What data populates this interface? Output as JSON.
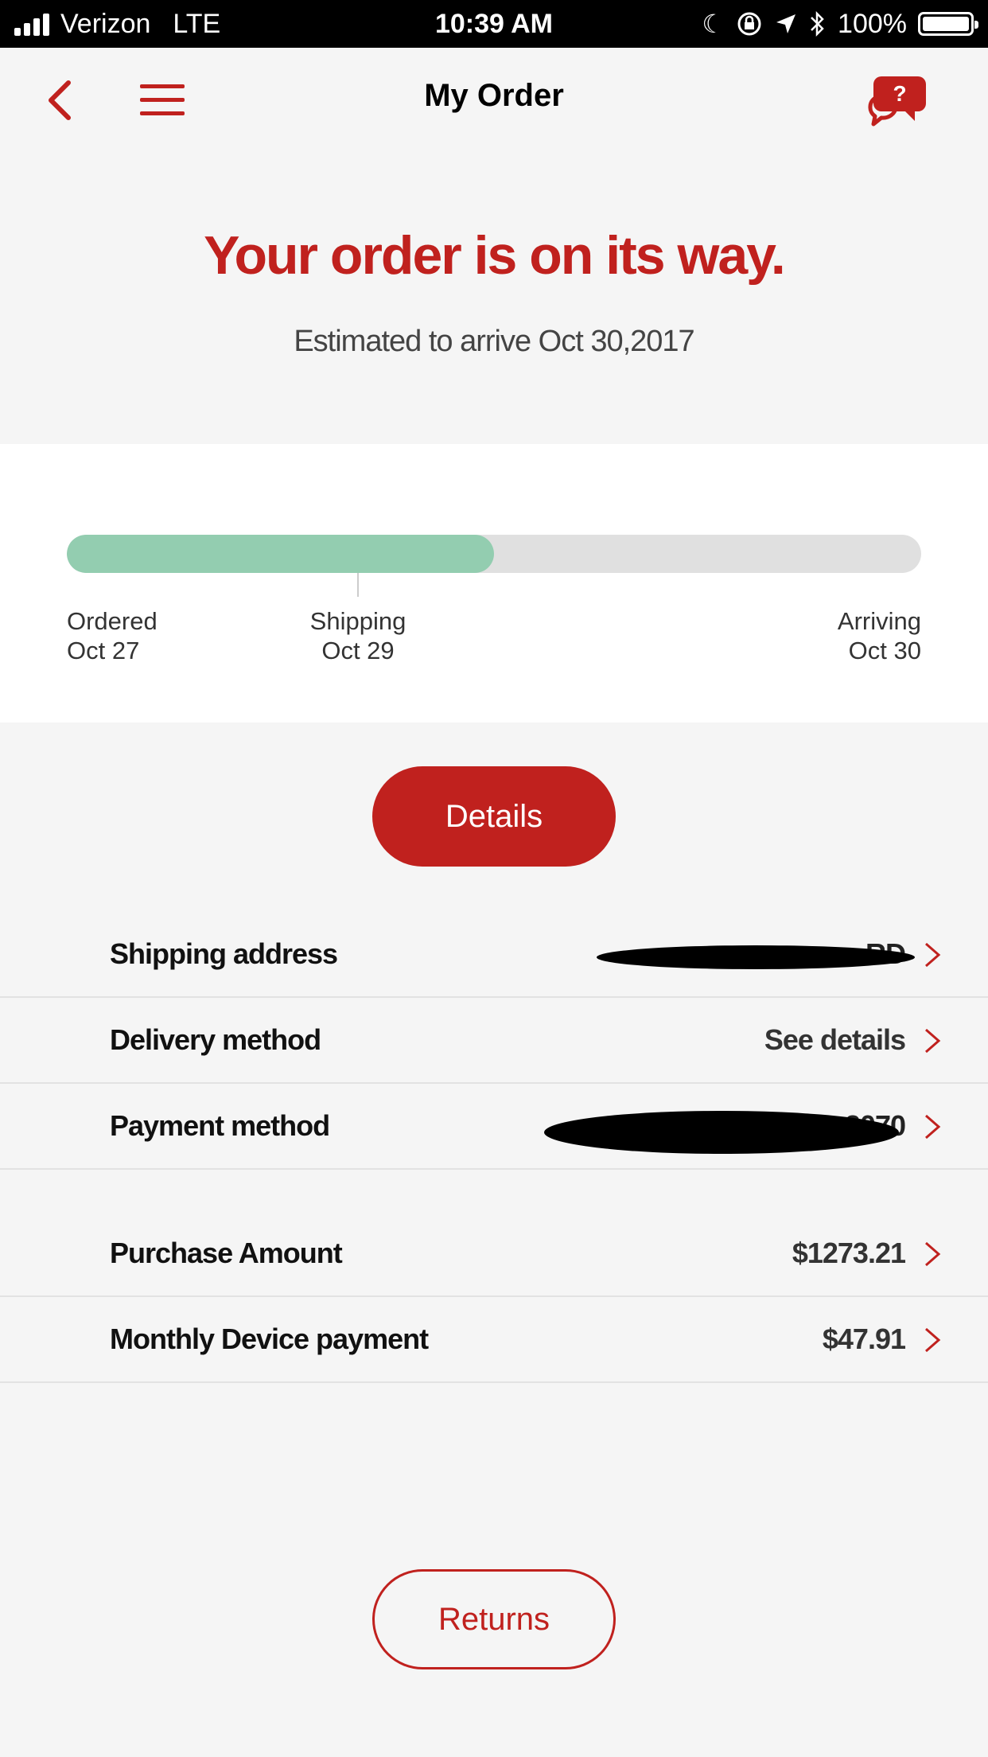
{
  "status_bar": {
    "carrier": "Verizon",
    "network": "LTE",
    "time": "10:39 AM",
    "battery": "100%"
  },
  "nav": {
    "title": "My Order",
    "chat_badge": "?"
  },
  "hero": {
    "headline": "Your order is on its way.",
    "eta": "Estimated to arrive Oct 30,2017"
  },
  "progress": {
    "fraction": 0.5,
    "stages": [
      {
        "label": "Ordered",
        "date": "Oct 27"
      },
      {
        "label": "Shipping",
        "date": "Oct 29"
      },
      {
        "label": "Arriving",
        "date": "Oct 30"
      }
    ]
  },
  "details_button": "Details",
  "rows": [
    {
      "label": "Shipping address",
      "value": "RD"
    },
    {
      "label": "Delivery method",
      "value": "See details"
    },
    {
      "label": "Payment method",
      "value": "Mas  2070"
    },
    {
      "label": "Purchase Amount",
      "value": "$1273.21"
    },
    {
      "label": "Monthly Device payment",
      "value": "$47.91"
    }
  ],
  "returns_button": "Returns",
  "colors": {
    "accent": "#c0211e",
    "progress_fill": "#93cdb0",
    "track": "#e0e0e0",
    "background": "#f5f5f5"
  }
}
